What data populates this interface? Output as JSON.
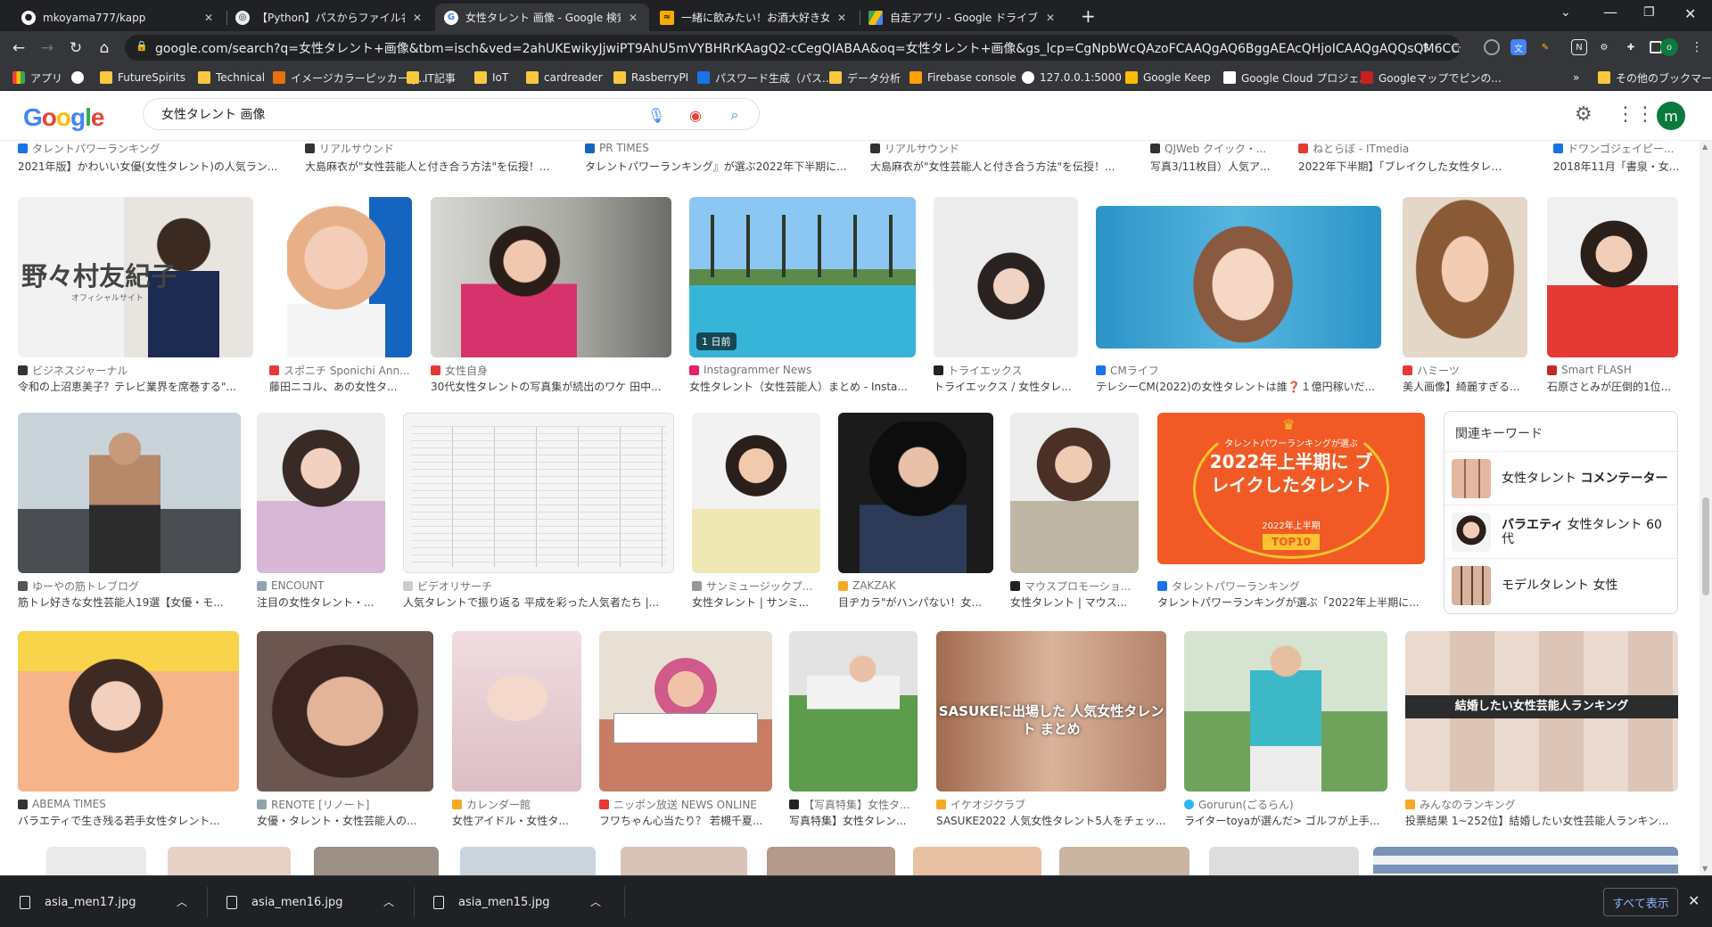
{
  "tabs": [
    {
      "title": "mkoyama777/kapp",
      "icon": "github-icon"
    },
    {
      "title": "【Python】パスからファイル名（拡張子",
      "icon": "page-icon"
    },
    {
      "title": "女性タレント 画像 - Google 検索",
      "icon": "google-icon",
      "active": true
    },
    {
      "title": "一緒に飲みたい！お酒大好き女性タ",
      "icon": "site-icon"
    },
    {
      "title": "自走アプリ - Google ドライブ",
      "icon": "drive-icon"
    }
  ],
  "new_tab_label": "+",
  "url": "google.com/search?q=女性タレント+画像&tbm=isch&ved=2ahUKEwikyJjwiPT9AhU5mVYBHRrKAagQ2-cCegQIABAA&oq=女性タレント+画像&gs_lcp=CgNpbWcQAzoFCAAQgAQ6BggAEAcQHjoICAAQgAQQsQM6CCgAEAQQgAQ...",
  "bookmarks": [
    {
      "label": "アプリ",
      "icon": "apps-icon"
    },
    {
      "label": "",
      "icon": "github-icon"
    },
    {
      "label": "FutureSpirits",
      "icon": "folder-icon"
    },
    {
      "label": "Technical",
      "icon": "folder-icon"
    },
    {
      "label": "イメージカラーピッカー |...",
      "icon": "site-icon"
    },
    {
      "label": "IT記事",
      "icon": "folder-icon"
    },
    {
      "label": "IoT",
      "icon": "folder-icon"
    },
    {
      "label": "cardreader",
      "icon": "folder-icon"
    },
    {
      "label": "RasberryPI",
      "icon": "folder-icon"
    },
    {
      "label": "パスワード生成（パス...",
      "icon": "site-icon"
    },
    {
      "label": "データ分析",
      "icon": "folder-icon"
    },
    {
      "label": "Firebase console",
      "icon": "firebase-icon"
    },
    {
      "label": "127.0.0.1:5000",
      "icon": "globe-icon"
    },
    {
      "label": "Google Keep",
      "icon": "keep-icon"
    },
    {
      "label": "Google Cloud プロジェ...",
      "icon": "cloud-icon"
    },
    {
      "label": "Googleマップでピンの...",
      "icon": "maps-icon"
    }
  ],
  "bookmarks_more": "»",
  "other_bookmarks": "その他のブックマーク",
  "google_logo": "Google",
  "search_query": "女性タレント 画像",
  "avatar_letter": "m",
  "top_row": [
    {
      "source": "タレントパワーランキング",
      "caption": "2021年版】かわいい女優(女性タレント)の人気ラン..."
    },
    {
      "source": "リアルサウンド",
      "caption": "大島麻衣が\"女性芸能人と付き合う方法\"を伝授！..."
    },
    {
      "source": "PR TIMES",
      "caption": "タレントパワーランキング』が選ぶ2022年下半期に..."
    },
    {
      "source": "リアルサウンド",
      "caption": "大島麻衣が\"女性芸能人と付き合う方法\"を伝授！..."
    },
    {
      "source": "QJWeb クイック・...",
      "caption": "写真3/11枚目）人気ア..."
    },
    {
      "source": "ねとらぼ - ITmedia",
      "caption": "2022年下半期】「ブレイクした女性タレント..."
    },
    {
      "source": "ドワンゴジェイピー...",
      "caption": "2018年11月「書泉・女..."
    }
  ],
  "row1": [
    {
      "source": "ビジネスジャーナル",
      "caption": "令和の上沼恵美子？テレビ業界を席巻する\"...",
      "overlay_title": "野々村友紀子",
      "overlay_sub": "オフィシャルサイト"
    },
    {
      "source": "スポニチ Sponichi Ann...",
      "caption": "藤田ニコル、あの女性タ..."
    },
    {
      "source": "女性自身",
      "caption": "30代女性タレントの写真集が続出のワケ 田中..."
    },
    {
      "source": "Instagrammer News",
      "caption": "女性タレント（女性芸能人）まとめ - Insta...",
      "badge": "1 日前"
    },
    {
      "source": "トライエックス",
      "caption": "トライエックス / 女性タレ..."
    },
    {
      "source": "CMライフ",
      "caption": "テレシーCM(2022)の女性タレントは誰❓１億円稼いだ..."
    },
    {
      "source": "ハミーツ",
      "caption": "美人画像】綺麗すぎる..."
    },
    {
      "source": "Smart FLASH",
      "caption": "石原さとみが圧倒的1位..."
    }
  ],
  "row2": [
    {
      "source": "ゆーやの筋トレブログ",
      "caption": "筋トレ好きな女性芸能人19選【女優・モ..."
    },
    {
      "source": "ENCOUNT",
      "caption": "注目の女性タレント・..."
    },
    {
      "source": "ビデオリサーチ",
      "caption": "人気タレントで振り返る 平成を彩った人気者たち |..."
    },
    {
      "source": "サンミュージックプ...",
      "caption": "女性タレント | サンミ..."
    },
    {
      "source": "ZAKZAK",
      "caption": "目ヂカラ\"がハンパない！女..."
    },
    {
      "source": "マウスプロモーショ...",
      "caption": "女性タレント | マウス..."
    },
    {
      "source": "タレントパワーランキング",
      "caption": "タレントパワーランキングが選ぶ「2022年上半期に...",
      "poster_small": "タレントパワーランキングが選ぶ",
      "poster_main": "2022年上半期に ブレイクしたタレント",
      "poster_year": "2022年上半期",
      "poster_badge": "TOP10"
    }
  ],
  "related": {
    "title": "関連キーワード",
    "items": [
      {
        "plain": "女性タレント ",
        "bold": "コメンテーター",
        "bold_first": false
      },
      {
        "plain": " 女性タレント 60代",
        "bold": "バラエティ",
        "bold_first": true
      },
      {
        "plain": "モデルタレント 女性",
        "bold": "",
        "bold_first": false
      }
    ]
  },
  "row3": [
    {
      "source": "ABEMA TIMES",
      "caption": "バラエティで生き残る若手女性タレント..."
    },
    {
      "source": "RENOTE [リノート]",
      "caption": "女優・タレント・女性芸能人の..."
    },
    {
      "source": "カレンダー館",
      "caption": "女性アイドル・女性タ..."
    },
    {
      "source": "ニッポン放送 NEWS ONLINE",
      "caption": "フワちゃん心当たり？ 若槻千夏..."
    },
    {
      "source": "【写真特集】女性タ...",
      "caption": "写真特集】女性タレン..."
    },
    {
      "source": "イケオジクラブ",
      "caption": "SASUKE2022 人気女性タレント5人をチェッ...",
      "overlay_title": "SASUKEに出場した 人気女性タレント まとめ"
    },
    {
      "source": "Gorurun(ごるらん)",
      "caption": "ライターtoyaが選んだ> ゴルフが上手..."
    },
    {
      "source": "みんなのランキング",
      "caption": "投票結果 1~252位】結婚したい女性芸能人ランキン...",
      "overlay_title": "結婚したい女性芸能人ランキング"
    }
  ],
  "downloads": [
    {
      "filename": "asia_men17.jpg"
    },
    {
      "filename": "asia_men16.jpg"
    },
    {
      "filename": "asia_men15.jpg"
    }
  ],
  "show_all": "すべて表示",
  "colors": {
    "chrome_dark": "#202124",
    "chrome_mid": "#35363a",
    "google_blue": "#4285f4",
    "poster_orange": "#f15a24"
  }
}
